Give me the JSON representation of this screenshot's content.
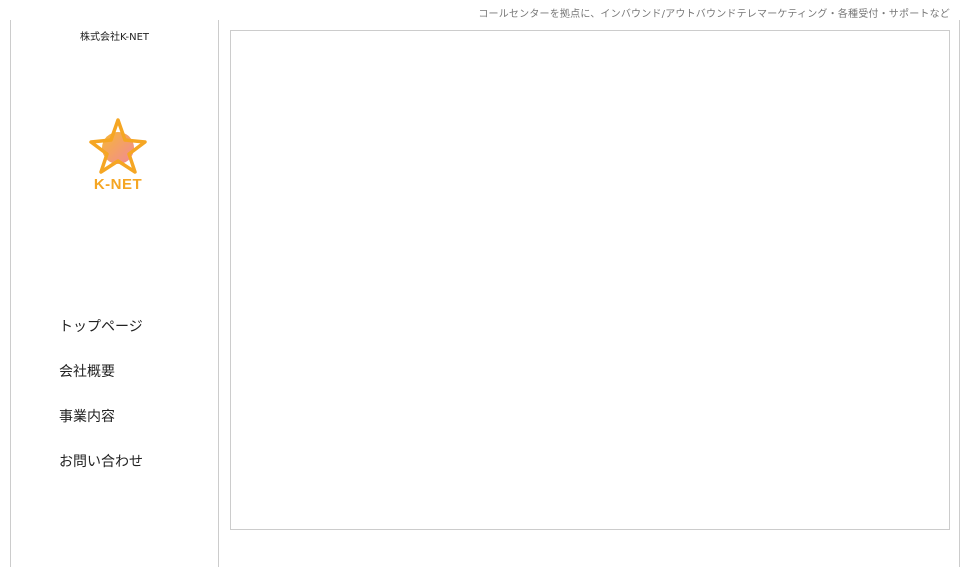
{
  "header": {
    "tagline": "コールセンターを拠点に、インバウンド/アウトバウンドテレマーケティング・各種受付・サポートなど"
  },
  "sidebar": {
    "company_name": "株式会社K-NET",
    "logo": {
      "text": "K-NET",
      "icon": "star-globe-logo",
      "colors": {
        "orange": "#f5a623",
        "pink": "#f0889a"
      }
    },
    "nav": [
      {
        "label": "トップページ"
      },
      {
        "label": "会社概要"
      },
      {
        "label": "事業内容"
      },
      {
        "label": "お問い合わせ"
      }
    ]
  }
}
